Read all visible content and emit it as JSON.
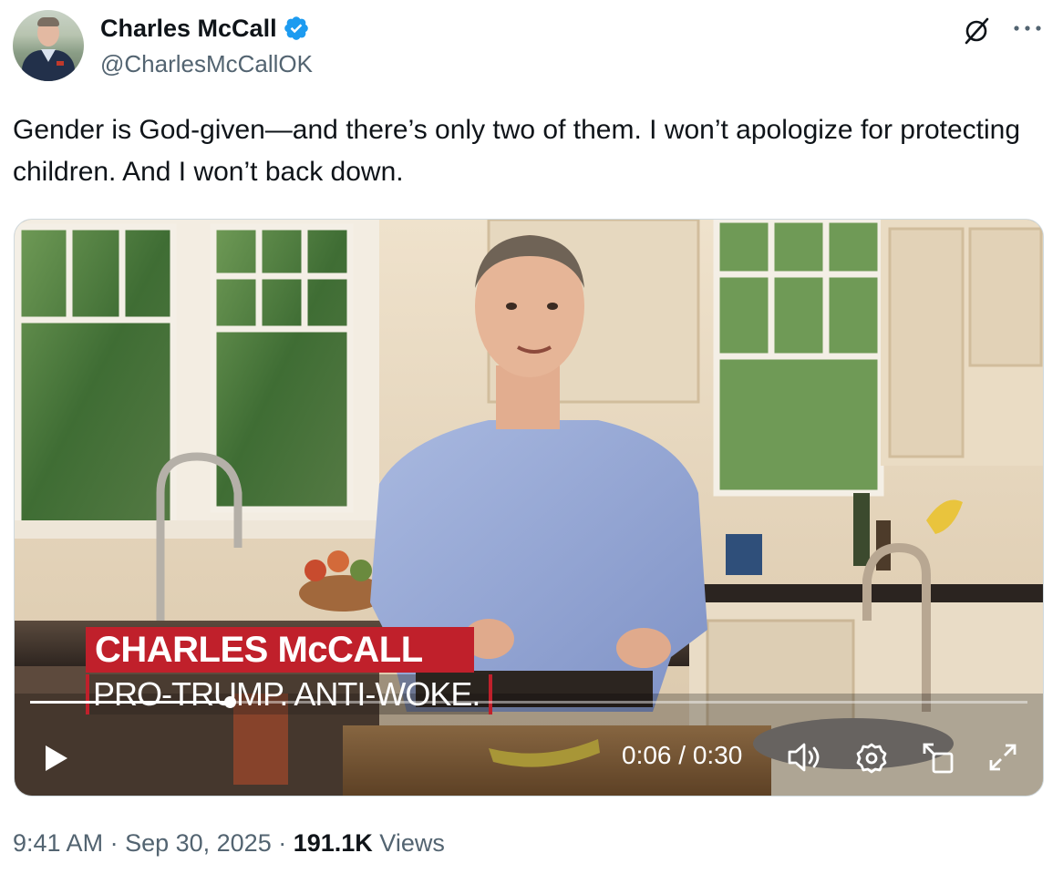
{
  "author": {
    "name": "Charles McCall",
    "handle": "@CharlesMcCallOK",
    "verified": true,
    "verified_color": "#1d9bf0"
  },
  "header_actions": {
    "grok_icon": "grok-icon",
    "more_icon": "more-icon"
  },
  "tweet": {
    "text": "Gender is God-given—and there’s only two of them. I won’t apologize for protecting children. And I won’t back down."
  },
  "video": {
    "overlay_name": "CHARLES McCALL",
    "overlay_tagline": "PRO-TRUMP. ANTI-WOKE.",
    "overlay_color": "#c0202b",
    "time_display": "0:06 / 0:30",
    "progress": 0.2,
    "controls": {
      "play_icon": "play-icon",
      "volume_icon": "volume-icon",
      "settings_icon": "settings-icon",
      "pip_icon": "picture-in-picture-icon",
      "fullscreen_icon": "fullscreen-icon"
    }
  },
  "footer": {
    "time": "9:41 AM",
    "sep1": " · ",
    "date": "Sep 30, 2025",
    "sep2": " · ",
    "views_count": "191.1K",
    "views_label": " Views"
  }
}
